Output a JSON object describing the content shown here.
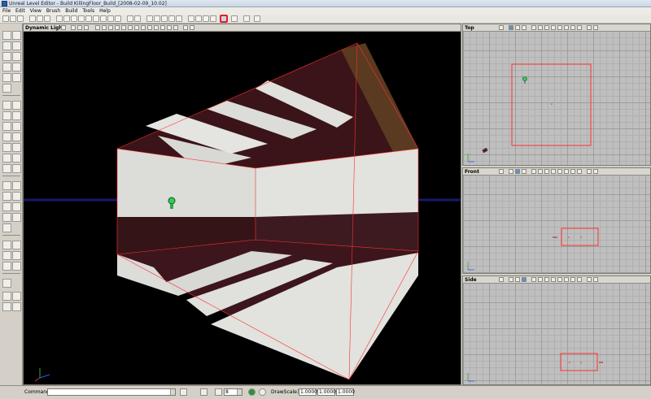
{
  "window": {
    "title": "Unreal Level Editor - Build KillingFloor_Build_[2008-02-09_10.02]"
  },
  "menu": [
    "File",
    "Edit",
    "View",
    "Brush",
    "Build",
    "Tools",
    "Help"
  ],
  "viewports": {
    "main": {
      "title": "Dynamic Light"
    },
    "top": {
      "title": "Top"
    },
    "front": {
      "title": "Front"
    },
    "side": {
      "title": "Side"
    }
  },
  "statusbar": {
    "command_label": "Command",
    "command_value": "",
    "grid_value": "8",
    "drawscale_label": "DrawScale3D",
    "drawscale_x": "1.0000",
    "drawscale_y": "1.0000",
    "drawscale_z": "1.0000"
  },
  "colors": {
    "highlight_button": "#e02020",
    "bsp_edge": "#ff3030",
    "light_actor": "#33cc55"
  }
}
